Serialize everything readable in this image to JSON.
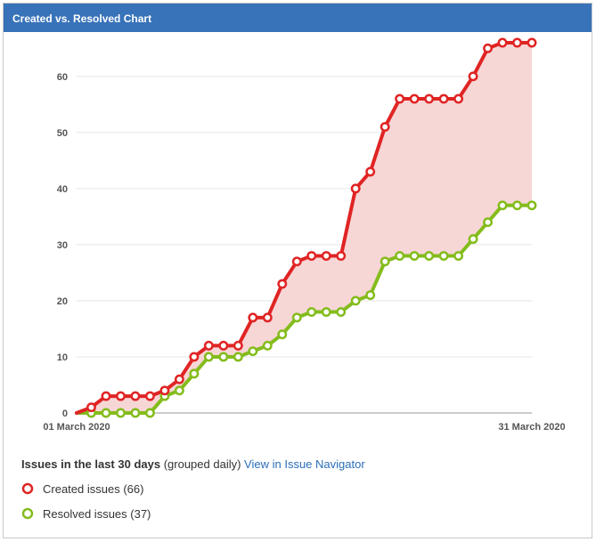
{
  "panel": {
    "title": "Created vs. Resolved Chart"
  },
  "legend": {
    "title": "Issues in the last 30 days",
    "subtitle": "(grouped daily)",
    "link_label": "View in Issue Navigator",
    "created_label": "Created issues (66)",
    "resolved_label": "Resolved issues (37)"
  },
  "colors": {
    "created": "#e02424",
    "resolved": "#84bc1c",
    "gap_fill": "#f7d6d6",
    "header": "#3873b9"
  },
  "chart_data": {
    "type": "line",
    "x_tick_labels": [
      "01 March 2020",
      "31 March 2020"
    ],
    "y_ticks": [
      0,
      10,
      20,
      30,
      40,
      50,
      60
    ],
    "ylim": [
      0,
      66
    ],
    "grid": true,
    "series": [
      {
        "name": "Created issues",
        "values": [
          0,
          1,
          3,
          3,
          3,
          3,
          4,
          6,
          10,
          12,
          12,
          12,
          17,
          17,
          23,
          27,
          28,
          28,
          28,
          40,
          43,
          51,
          56,
          56,
          56,
          56,
          56,
          60,
          65,
          66,
          66,
          66
        ]
      },
      {
        "name": "Resolved issues",
        "values": [
          0,
          0,
          0,
          0,
          0,
          0,
          3,
          4,
          7,
          10,
          10,
          10,
          11,
          12,
          14,
          17,
          18,
          18,
          18,
          20,
          21,
          27,
          28,
          28,
          28,
          28,
          28,
          31,
          34,
          37,
          37,
          37
        ]
      }
    ]
  }
}
